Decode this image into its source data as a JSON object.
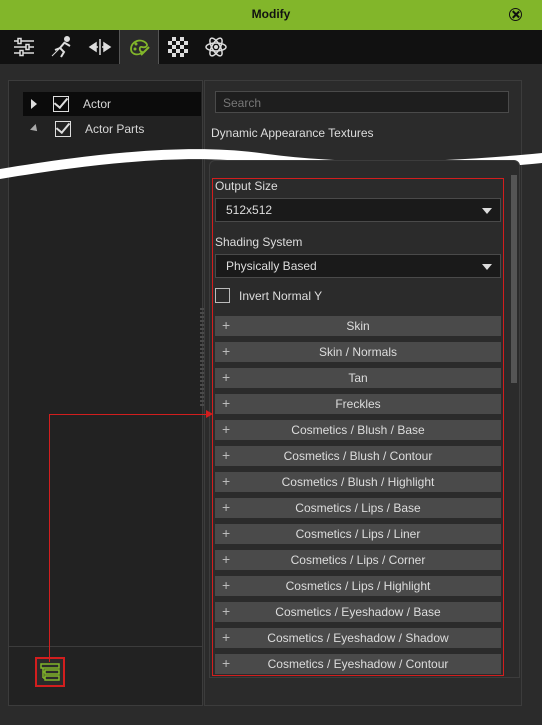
{
  "window": {
    "title": "Modify"
  },
  "toolbar": {
    "tabs": [
      {
        "icon": "sliders-icon"
      },
      {
        "icon": "motion-icon"
      },
      {
        "icon": "transform-icon"
      },
      {
        "icon": "appearance-icon",
        "active": true
      },
      {
        "icon": "checker-texture-icon"
      },
      {
        "icon": "atom-icon"
      }
    ]
  },
  "tree": {
    "items": [
      {
        "label": "Actor",
        "checked": true,
        "expanded": false,
        "selected": true
      },
      {
        "label": "Actor Parts",
        "checked": true,
        "expanded": true,
        "selected": false
      }
    ]
  },
  "right_panel": {
    "search_placeholder": "Search",
    "section_title": "Dynamic Appearance Textures",
    "output_size_label": "Output Size",
    "output_size_value": "512x512",
    "shading_system_label": "Shading System",
    "shading_system_value": "Physically Based",
    "invert_label": "Invert Normal Y",
    "invert_checked": false,
    "layers": [
      "Skin",
      "Skin / Normals",
      "Tan",
      "Freckles",
      "Cosmetics / Blush / Base",
      "Cosmetics / Blush / Contour",
      "Cosmetics / Blush / Highlight",
      "Cosmetics / Lips / Base",
      "Cosmetics / Lips / Liner",
      "Cosmetics / Lips / Corner",
      "Cosmetics / Lips / Highlight",
      "Cosmetics / Eyeshadow / Base",
      "Cosmetics / Eyeshadow / Shadow",
      "Cosmetics / Eyeshadow / Contour"
    ]
  },
  "colors": {
    "accent": "#82b62a",
    "highlight_red": "#d21e1e"
  }
}
